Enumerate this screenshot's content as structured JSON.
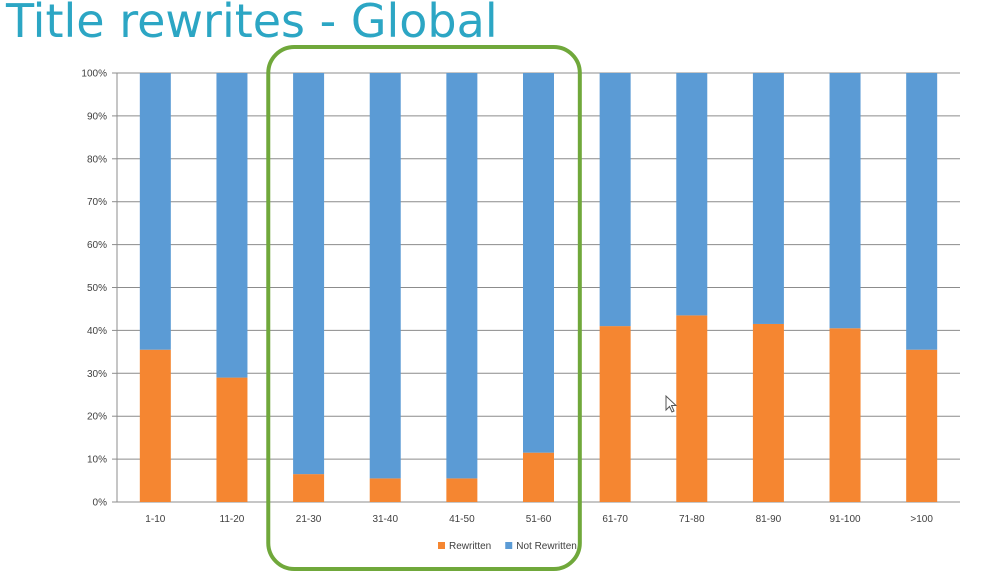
{
  "slide": {
    "title": "Title rewrites - Global"
  },
  "chart_data": {
    "type": "bar",
    "stacked": true,
    "percent": true,
    "categories": [
      "1-10",
      "11-20",
      "21-30",
      "31-40",
      "41-50",
      "51-60",
      "61-70",
      "71-80",
      "81-90",
      "91-100",
      ">100"
    ],
    "series": [
      {
        "name": "Rewritten",
        "color": "#f58631",
        "values": [
          35.5,
          29,
          6.5,
          5.5,
          5.5,
          11.5,
          41,
          43.5,
          41.5,
          40.5,
          35.5
        ]
      },
      {
        "name": "Not Rewritten",
        "color": "#5b9bd5",
        "values": [
          64.5,
          71,
          93.5,
          94.5,
          94.5,
          88.5,
          59,
          56.5,
          58.5,
          59.5,
          64.5
        ]
      }
    ],
    "yticks": [
      "0%",
      "10%",
      "20%",
      "30%",
      "40%",
      "50%",
      "60%",
      "70%",
      "80%",
      "90%",
      "100%"
    ],
    "ylim": [
      0,
      100
    ],
    "grid": true,
    "legend_position": "bottom",
    "highlight": {
      "from_category": "21-30",
      "to_category": "51-60",
      "color": "#70a83b"
    }
  }
}
